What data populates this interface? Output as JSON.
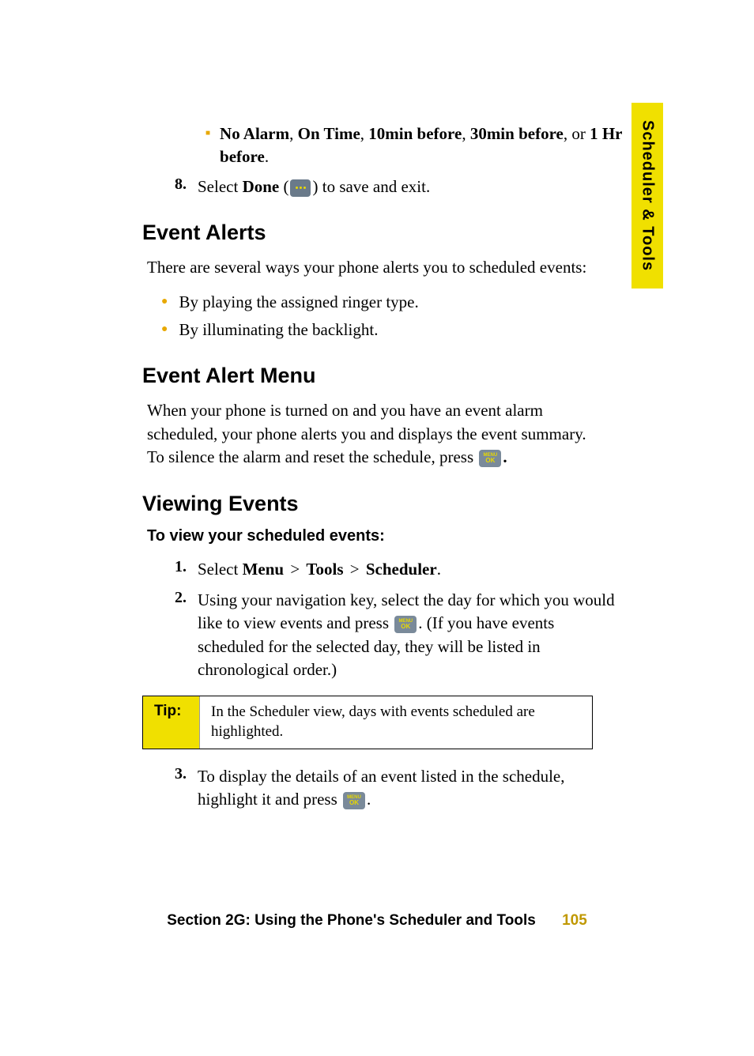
{
  "side_tab": "Scheduler & Tools",
  "alarm_options": {
    "opt1": "No Alarm",
    "opt2": "On Time",
    "opt3": "10min before",
    "opt4": "30min before",
    "sep_comma": ", ",
    "sep_or": ", or ",
    "opt5": "1 Hr  before",
    "period": "."
  },
  "step8": {
    "num": "8.",
    "prefix": "Select ",
    "done": "Done",
    "lparen": " (",
    "rparen": ") ",
    "suffix": "to save and exit."
  },
  "event_alerts": {
    "heading": "Event Alerts",
    "intro": "There are several ways your phone alerts you to scheduled events:",
    "b1": "By playing the assigned ringer type.",
    "b2": "By illuminating the backlight."
  },
  "event_alert_menu": {
    "heading": "Event Alert Menu",
    "para_pre": "When your phone is turned on and you have an event alarm scheduled, your phone alerts you and displays the event summary. To silence the alarm and reset the schedule, press ",
    "para_post": "."
  },
  "viewing_events": {
    "heading": "Viewing Events",
    "subhead": "To view your scheduled events:",
    "step1": {
      "num": "1.",
      "prefix": "Select ",
      "menu": "Menu",
      "gt": " > ",
      "tools": "Tools",
      "scheduler": "Scheduler",
      "period": "."
    },
    "step2": {
      "num": "2.",
      "pre": "Using your navigation key, select the day for which you would like to view events and press ",
      "post": ". (If you have events scheduled for the selected day, they will be listed in chronological order.)"
    },
    "tip": {
      "label": "Tip:",
      "text": "In the Scheduler view, days with events scheduled are highlighted."
    },
    "step3": {
      "num": "3.",
      "pre": "To display the details of an event listed in the schedule, highlight it and press ",
      "post": "."
    }
  },
  "footer": {
    "section": "Section 2G: Using the Phone's Scheduler and Tools",
    "page": "105"
  },
  "icon_labels": {
    "menu": "MENU",
    "ok": "OK"
  }
}
